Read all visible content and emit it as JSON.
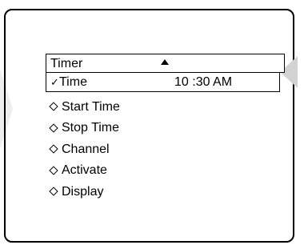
{
  "menu": {
    "title": "Timer",
    "selected": {
      "check": "✓",
      "label": "Time",
      "value": "10 :30 AM"
    },
    "items": [
      {
        "label": "Start Time"
      },
      {
        "label": "Stop Time"
      },
      {
        "label": "Channel"
      },
      {
        "label": "Activate"
      },
      {
        "label": "Display"
      }
    ]
  },
  "icons": {
    "scroll_up": "up-arrow-icon",
    "item_bullet": "diamond-bullet-icon",
    "selected_mark": "check-icon"
  },
  "colors": {
    "frame": "#000000",
    "background": "#ffffff",
    "pointer": "#d2d2d2"
  }
}
